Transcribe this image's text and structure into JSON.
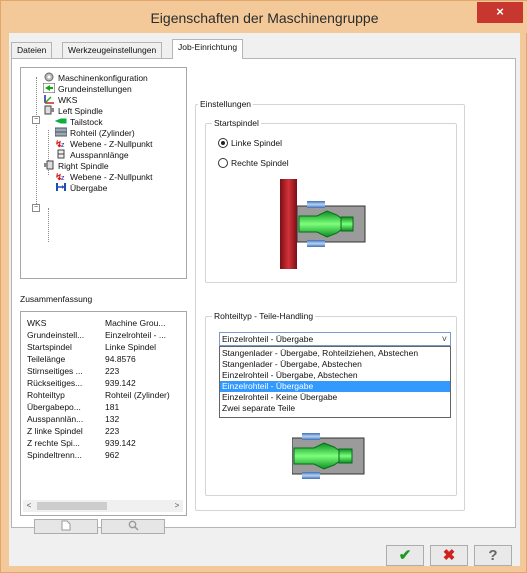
{
  "window": {
    "title": "Eigenschaften der Maschinengruppe",
    "close_icon": "×"
  },
  "tabs": [
    "Dateien",
    "Werkzeugeinstellungen",
    "Job-Einrichtung"
  ],
  "tree": {
    "items": [
      {
        "label": "Maschinenkonfiguration",
        "icon": "gear-icon"
      },
      {
        "label": "Grundeinstellungen",
        "icon": "green-arrow-icon"
      },
      {
        "label": "WKS",
        "icon": "axes-icon"
      },
      {
        "label": "Left Spindle",
        "icon": "spindle-icon"
      },
      {
        "label": "Tailstock",
        "icon": "tailstock-icon"
      },
      {
        "label": "Rohteil (Zylinder)",
        "icon": "stock-icon"
      },
      {
        "label": "Webene - Z-Nullpunkt",
        "icon": "z-zero-icon"
      },
      {
        "label": "Ausspannlänge",
        "icon": "chuck-icon"
      },
      {
        "label": "Right Spindle",
        "icon": "spindle-icon"
      },
      {
        "label": "Webene - Z-Nullpunkt",
        "icon": "z-zero-icon"
      },
      {
        "label": "Übergabe",
        "icon": "transfer-icon"
      }
    ],
    "item4_label": "Tailstock"
  },
  "summary": {
    "label": "Zusammenfassung",
    "rows": [
      {
        "k": "WKS",
        "v": "Machine Grou..."
      },
      {
        "k": "Grundeinstell...",
        "v": "Einzelrohteil - ..."
      },
      {
        "k": "Startspindel",
        "v": "Linke Spindel"
      },
      {
        "k": "Teilelänge",
        "v": "94.8576"
      },
      {
        "k": "Stirnseitiges ...",
        "v": "223"
      },
      {
        "k": "Rückseitiges...",
        "v": "939.142"
      },
      {
        "k": "Rohteiltyp",
        "v": "Rohteil (Zylinder)"
      },
      {
        "k": "Übergabepo...",
        "v": "181"
      },
      {
        "k": "Ausspannlän...",
        "v": "132"
      },
      {
        "k": "Z linke Spindel",
        "v": "223"
      },
      {
        "k": "Z rechte Spi...",
        "v": "939.142"
      },
      {
        "k": "Spindeltrenn...",
        "v": "962"
      }
    ]
  },
  "settings": {
    "group_label": "Einstellungen",
    "startspindel": {
      "label": "Startspindel",
      "options": [
        "Linke Spindel",
        "Rechte Spindel"
      ],
      "selected": 0
    },
    "rohteiltyp": {
      "label": "Rohteiltyp - Teile-Handling",
      "value": "Einzelrohteil - Übergabe",
      "options": [
        "Stangenlader - Übergabe, Rohteilziehen, Abstechen",
        "Stangenlader - Übergabe, Abstechen",
        "Einzelrohteil - Übergabe, Abstechen",
        "Einzelrohteil - Übergabe",
        "Einzelrohteil - Keine Übergabe",
        "Zwei separate Teile"
      ],
      "selected": 3
    }
  },
  "footer": {
    "ok": "✔",
    "cancel": "✖",
    "help": "?"
  }
}
